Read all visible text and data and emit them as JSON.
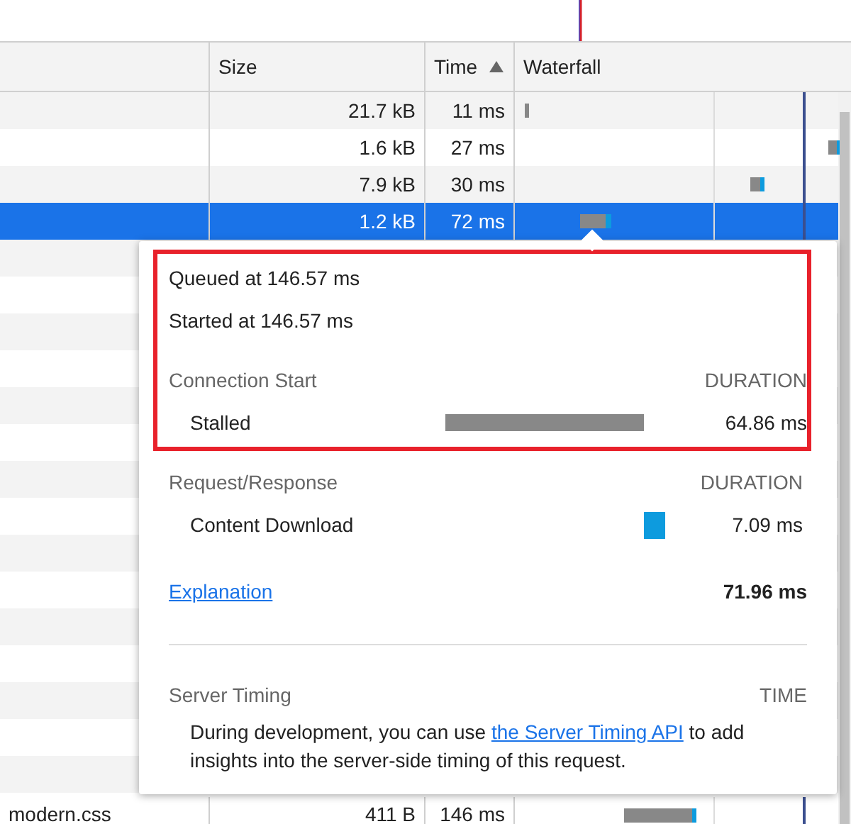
{
  "columns": [
    {
      "label": "Size",
      "sort_ascending": false
    },
    {
      "label": "Time",
      "sort_ascending": true
    },
    {
      "label": "Waterfall",
      "sort_ascending": false
    }
  ],
  "rows": [
    {
      "size": "21.7 kB",
      "time": "11 ms",
      "selected": false
    },
    {
      "size": "1.6 kB",
      "time": "27 ms",
      "selected": false
    },
    {
      "size": "7.9 kB",
      "time": "30 ms",
      "selected": false
    },
    {
      "size": "1.2 kB",
      "time": "72 ms",
      "selected": true
    }
  ],
  "last_row": {
    "name": "modern.css",
    "size": "411 B",
    "time": "146 ms",
    "selected": false
  },
  "popover": {
    "groups": [
      {
        "outlined": true,
        "lines": [
          "Queued at 146.57 ms",
          "Started at 146.57 ms"
        ],
        "section": {
          "title": "Connection Start",
          "heading": "DURATION",
          "items": [
            {
              "label": "Stalled",
              "kind": "stalled",
              "duration": "64.86 ms"
            }
          ]
        }
      },
      {
        "outlined": false,
        "section": {
          "title": "Request/Response",
          "heading": "DURATION",
          "items": [
            {
              "label": "Content Download",
              "kind": "download",
              "duration": "7.09 ms"
            }
          ]
        }
      }
    ],
    "explanation": "Explanation",
    "total": "71.96 ms",
    "server_timing": {
      "title": "Server Timing",
      "heading": "TIME",
      "note_before": "During development, you can use ",
      "note_link": "the Server Timing API",
      "note_after": " to add insights into the server-side timing of this request."
    }
  }
}
